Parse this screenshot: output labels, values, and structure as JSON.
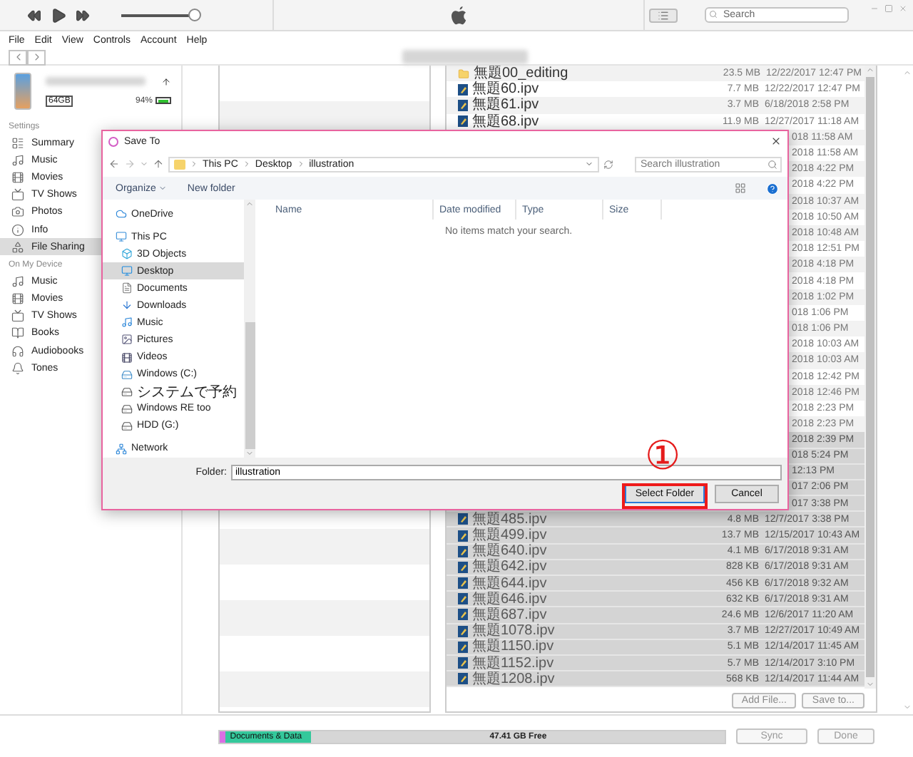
{
  "toolbar": {
    "volume": {
      "level": 0.96
    },
    "search": {
      "placeholder": "Search"
    }
  },
  "menu": [
    "File",
    "Edit",
    "View",
    "Controls",
    "Account",
    "Help"
  ],
  "sidebar": {
    "device": {
      "capacity": "64GB",
      "battery": "94%"
    },
    "sections": [
      {
        "heading": "Settings",
        "items": [
          {
            "label": "Summary",
            "selected": false
          },
          {
            "label": "Music",
            "selected": false
          },
          {
            "label": "Movies",
            "selected": false
          },
          {
            "label": "TV Shows",
            "selected": false
          },
          {
            "label": "Photos",
            "selected": false
          },
          {
            "label": "Info",
            "selected": false
          },
          {
            "label": "File Sharing",
            "selected": true
          }
        ]
      },
      {
        "heading": "On My Device",
        "items": [
          {
            "label": "Music",
            "selected": false
          },
          {
            "label": "Movies",
            "selected": false
          },
          {
            "label": "TV Shows",
            "selected": false
          },
          {
            "label": "Books",
            "selected": false
          },
          {
            "label": "Audiobooks",
            "selected": false
          },
          {
            "label": "Tones",
            "selected": false
          }
        ]
      }
    ]
  },
  "files": {
    "rows": [
      {
        "kind": "folder",
        "name": "無題00_editing",
        "size": "23.5 MB",
        "date": "12/22/2017 12:47 PM",
        "selected": false
      },
      {
        "kind": "file",
        "name": "無題60.ipv",
        "size": "7.7 MB",
        "date": "12/22/2017 12:47 PM",
        "selected": false
      },
      {
        "kind": "file",
        "name": "無題61.ipv",
        "size": "3.7 MB",
        "date": "6/18/2018 2:58 PM",
        "selected": false
      },
      {
        "kind": "file",
        "name": "無題68.ipv",
        "size": "11.9 MB",
        "date": "12/27/2017 11:18 AM",
        "selected": false
      },
      {
        "kind": "covered",
        "date": "018 11:58 AM",
        "selected": false
      },
      {
        "kind": "covered",
        "date": "2018 11:58 AM",
        "selected": false
      },
      {
        "kind": "covered",
        "date": "2018 4:22 PM",
        "selected": false
      },
      {
        "kind": "covered",
        "date": "2018 4:22 PM",
        "selected": false
      },
      {
        "kind": "covered",
        "date": "2018 10:37 AM",
        "selected": false
      },
      {
        "kind": "covered",
        "date": "2018 10:50 AM",
        "selected": false
      },
      {
        "kind": "covered",
        "date": "2018 10:48 AM",
        "selected": false
      },
      {
        "kind": "covered",
        "date": "2018 12:51 PM",
        "selected": false
      },
      {
        "kind": "covered",
        "date": "2018 4:18 PM",
        "selected": false
      },
      {
        "kind": "covered",
        "date": "2018 4:18 PM",
        "selected": false
      },
      {
        "kind": "covered",
        "date": "2018 1:02 PM",
        "selected": false
      },
      {
        "kind": "covered",
        "date": "018 1:06 PM",
        "selected": false
      },
      {
        "kind": "covered",
        "date": "018 1:06 PM",
        "selected": false
      },
      {
        "kind": "covered",
        "date": "2018 10:03 AM",
        "selected": false
      },
      {
        "kind": "covered",
        "date": "2018 10:03 AM",
        "selected": false
      },
      {
        "kind": "covered",
        "date": "2018 12:42 PM",
        "selected": false
      },
      {
        "kind": "covered",
        "date": "2018 12:46 PM",
        "selected": false
      },
      {
        "kind": "covered",
        "date": "2018 2:23 PM",
        "selected": false
      },
      {
        "kind": "covered",
        "date": "2018 2:23 PM",
        "selected": false
      },
      {
        "kind": "covered",
        "date": "2018 2:39 PM",
        "selected": true
      },
      {
        "kind": "covered",
        "date": "018 5:24 PM",
        "selected": true
      },
      {
        "kind": "covered",
        "date": "12:13 PM",
        "selected": true
      },
      {
        "kind": "covered",
        "date": "017 2:06 PM",
        "selected": true
      },
      {
        "kind": "covered",
        "date": "017 3:38 PM",
        "selected": true
      },
      {
        "kind": "file",
        "name": "無題485.ipv",
        "size": "4.8 MB",
        "date": "12/7/2017 3:38 PM",
        "selected": true
      },
      {
        "kind": "file",
        "name": "無題499.ipv",
        "size": "13.7 MB",
        "date": "12/15/2017 10:43 AM",
        "selected": true
      },
      {
        "kind": "file",
        "name": "無題640.ipv",
        "size": "4.1 MB",
        "date": "6/17/2018 9:31 AM",
        "selected": true
      },
      {
        "kind": "file",
        "name": "無題642.ipv",
        "size": "828 KB",
        "date": "6/17/2018 9:31 AM",
        "selected": true
      },
      {
        "kind": "file",
        "name": "無題644.ipv",
        "size": "456 KB",
        "date": "6/17/2018 9:32 AM",
        "selected": true
      },
      {
        "kind": "file",
        "name": "無題646.ipv",
        "size": "632 KB",
        "date": "6/17/2018 9:31 AM",
        "selected": true
      },
      {
        "kind": "file",
        "name": "無題687.ipv",
        "size": "24.6 MB",
        "date": "12/6/2017 11:20 AM",
        "selected": true
      },
      {
        "kind": "file",
        "name": "無題1078.ipv",
        "size": "3.7 MB",
        "date": "12/27/2017 10:49 AM",
        "selected": true
      },
      {
        "kind": "file",
        "name": "無題1150.ipv",
        "size": "5.1 MB",
        "date": "12/14/2017 11:45 AM",
        "selected": true
      },
      {
        "kind": "file",
        "name": "無題1152.ipv",
        "size": "5.7 MB",
        "date": "12/14/2017 3:10 PM",
        "selected": true
      },
      {
        "kind": "file",
        "name": "無題1208.ipv",
        "size": "568 KB",
        "date": "12/14/2017 11:44 AM",
        "selected": true
      }
    ],
    "buttons": [
      "Add File...",
      "Save to..."
    ]
  },
  "storage": {
    "segments": [
      {
        "color": "#d96fe3",
        "level": 0.012
      },
      {
        "label": "Documents & Data",
        "color": "#34c89b",
        "level": 0.17
      }
    ],
    "free": "47.41 GB Free"
  },
  "footer_buttons": [
    "Sync",
    "Done"
  ],
  "dialog": {
    "title": "Save To",
    "path": [
      "This PC",
      "Desktop",
      "illustration"
    ],
    "search": {
      "placeholder": "Search illustration"
    },
    "toolbar": [
      "Organize",
      "New folder"
    ],
    "nav": [
      {
        "label": "OneDrive",
        "selected": false
      },
      {
        "label": "This PC",
        "selected": false,
        "children": [
          {
            "label": "3D Objects",
            "selected": false
          },
          {
            "label": "Desktop",
            "selected": true
          },
          {
            "label": "Documents",
            "selected": false
          },
          {
            "label": "Downloads",
            "selected": false
          },
          {
            "label": "Music",
            "selected": false
          },
          {
            "label": "Pictures",
            "selected": false
          },
          {
            "label": "Videos",
            "selected": false
          },
          {
            "label": "Windows (C:)",
            "selected": false
          },
          {
            "label": "システムで予約",
            "selected": false
          },
          {
            "label": "Windows RE too",
            "selected": false
          },
          {
            "label": "HDD (G:)",
            "selected": false
          }
        ]
      },
      {
        "label": "Network",
        "selected": false
      }
    ],
    "columns": [
      "Name",
      "Date modified",
      "Type",
      "Size"
    ],
    "empty_message": "No items match your search.",
    "folder": {
      "label": "Folder:",
      "value": "illustration"
    },
    "buttons": [
      "Select Folder",
      "Cancel"
    ]
  },
  "annotation": {
    "label": "①"
  }
}
